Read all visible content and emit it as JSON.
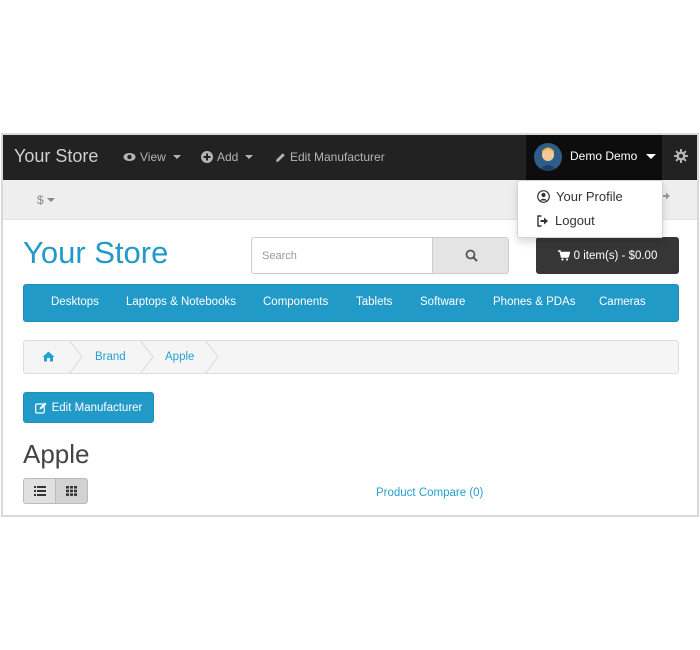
{
  "admin_bar": {
    "brand": "Your Store",
    "menu": {
      "view": "View",
      "add": "Add",
      "edit_manufacturer": "Edit Manufacturer"
    },
    "user": "Demo Demo",
    "colors": {
      "background": "#222222",
      "user_background": "#0d0d0d"
    }
  },
  "user_dropdown": {
    "items": [
      {
        "label": "Your Profile",
        "icon": "user-circle-icon"
      },
      {
        "label": "Logout",
        "icon": "sign-out-icon"
      }
    ]
  },
  "top_bar": {
    "currency": "$"
  },
  "header": {
    "logo": "Your Store",
    "search": {
      "placeholder": "Search",
      "value": ""
    },
    "cart": {
      "label": "0 item(s) - $0.00"
    }
  },
  "categories": [
    "Desktops",
    "Laptops & Notebooks",
    "Components",
    "Tablets",
    "Software",
    "Phones & PDAs",
    "Cameras"
  ],
  "breadcrumb": {
    "home_icon": "home-icon",
    "items": [
      "Brand",
      "Apple"
    ]
  },
  "content": {
    "edit_button": "Edit Manufacturer",
    "heading": "Apple",
    "view_modes": [
      "list-view-icon",
      "grid-view-icon"
    ],
    "product_compare": "Product Compare (0)"
  },
  "colors": {
    "accent": "#229ac8",
    "link": "#23a1d1",
    "cart": "#363636"
  }
}
